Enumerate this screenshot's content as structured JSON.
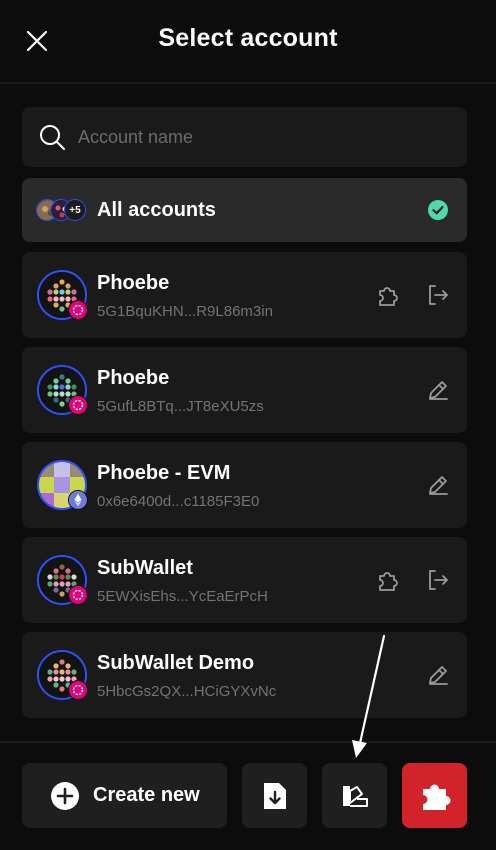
{
  "header": {
    "title": "Select account"
  },
  "search": {
    "placeholder": "Account name"
  },
  "all_accounts": {
    "label": "All accounts",
    "extra_count": "+5"
  },
  "accounts": [
    {
      "name": "Phoebe",
      "address": "5G1BquKHN...R9L86m3in",
      "network": "polkadot",
      "actions": [
        "puzzle-icon",
        "logout-icon"
      ]
    },
    {
      "name": "Phoebe",
      "address": "5GufL8BTq...JT8eXU5zs",
      "network": "polkadot",
      "actions": [
        "edit-icon"
      ]
    },
    {
      "name": "Phoebe - EVM",
      "address": "0x6e6400d...c1185F3E0",
      "network": "ethereum",
      "actions": [
        "edit-icon"
      ]
    },
    {
      "name": "SubWallet",
      "address": "5EWXisEhs...YcEaErPcH",
      "network": "polkadot",
      "actions": [
        "puzzle-icon",
        "logout-icon"
      ]
    },
    {
      "name": "SubWallet Demo",
      "address": "5HbcGs2QX...HCiGYXvNc",
      "network": "polkadot",
      "actions": [
        "edit-icon"
      ]
    }
  ],
  "footer": {
    "create_label": "Create new",
    "buttons": [
      "import-icon",
      "theme-swatch-icon",
      "extension-puzzle-icon"
    ]
  },
  "colors": {
    "background": "#0c0c0c",
    "card": "#1a1a1a",
    "selected_card": "#2a2a2a",
    "accent_check": "#4cd9ac",
    "danger_button": "#d2232a",
    "avatar_ring": "#2b52ff",
    "polkadot_badge": "#e6007a"
  }
}
